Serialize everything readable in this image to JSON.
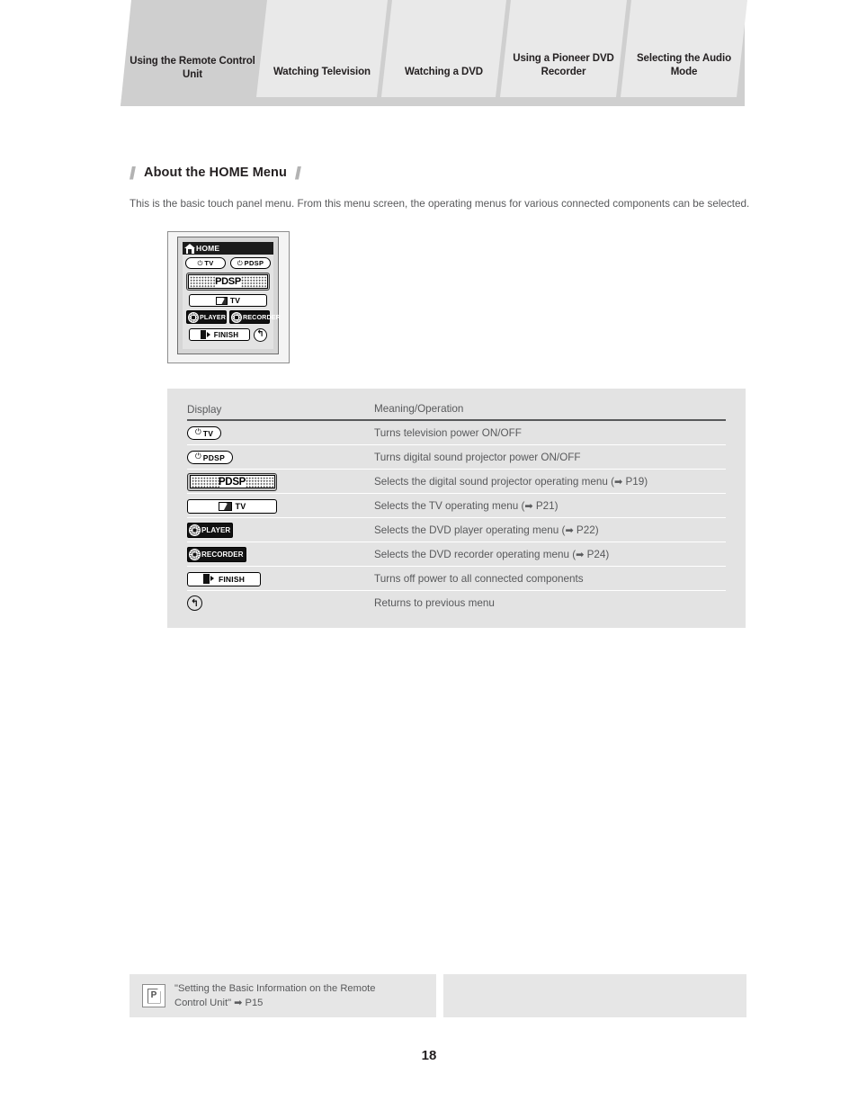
{
  "header": {
    "tabs": [
      {
        "label": "Using the Remote Control Unit",
        "active": true
      },
      {
        "label": "Watching Television",
        "active": false
      },
      {
        "label": "Watching a DVD",
        "active": false
      },
      {
        "label": "Using a Pioneer DVD Recorder",
        "active": false
      },
      {
        "label": "Selecting the Audio Mode",
        "active": false
      }
    ]
  },
  "section": {
    "heading": "About the HOME Menu",
    "intro": "This is the basic touch panel menu. From this menu screen, the operating menus for various connected components can be selected."
  },
  "remote": {
    "title": "HOME",
    "home_icon": "home-icon",
    "power_tv": {
      "glyph": "⏻",
      "label": "TV"
    },
    "power_pdsp": {
      "glyph": "⏻",
      "label": "PDSP"
    },
    "pdsp_bar": "PDSP",
    "tv_bar": "TV",
    "player": "PLAYER",
    "recorder": "RECORDER",
    "finish": "FINISH",
    "return_glyph": "↰"
  },
  "table": {
    "columns": [
      "Display",
      "Meaning/Operation"
    ],
    "rows": [
      {
        "widget": "pill-tv",
        "meaning": "Turns television power ON/OFF"
      },
      {
        "widget": "pill-pdsp",
        "meaning": "Turns digital sound projector power ON/OFF"
      },
      {
        "widget": "bar-pdsp",
        "meaning": "Selects the digital sound projector operating menu (",
        "arrow": "➡",
        "ref": " P19)"
      },
      {
        "widget": "bar-tv",
        "meaning": "Selects the TV operating menu (",
        "arrow": "➡",
        "ref": " P21)"
      },
      {
        "widget": "btn-player",
        "meaning": "Selects the DVD player operating menu (",
        "arrow": "➡",
        "ref": " P22)"
      },
      {
        "widget": "btn-recorder",
        "meaning": "Selects the DVD recorder operating menu (",
        "arrow": "➡",
        "ref": " P24)"
      },
      {
        "widget": "btn-finish",
        "meaning": "Turns off power to all connected components"
      },
      {
        "widget": "btn-return",
        "meaning": "Returns to previous menu"
      }
    ]
  },
  "footer": {
    "note": {
      "icon_letter": "P",
      "text_line1": "\"Setting the Basic Information on the Remote",
      "text_line2": "Control Unit\"",
      "arrow": "➡",
      "ref": " P15"
    }
  },
  "page_number": "18",
  "colors": {
    "tab_active": "#cfcfcf",
    "tab_inactive": "#e9e9e9",
    "table_bg": "#e3e3e3",
    "note_bg": "#e6e6e6",
    "body_text": "#58595b",
    "heading_text": "#231f20"
  }
}
